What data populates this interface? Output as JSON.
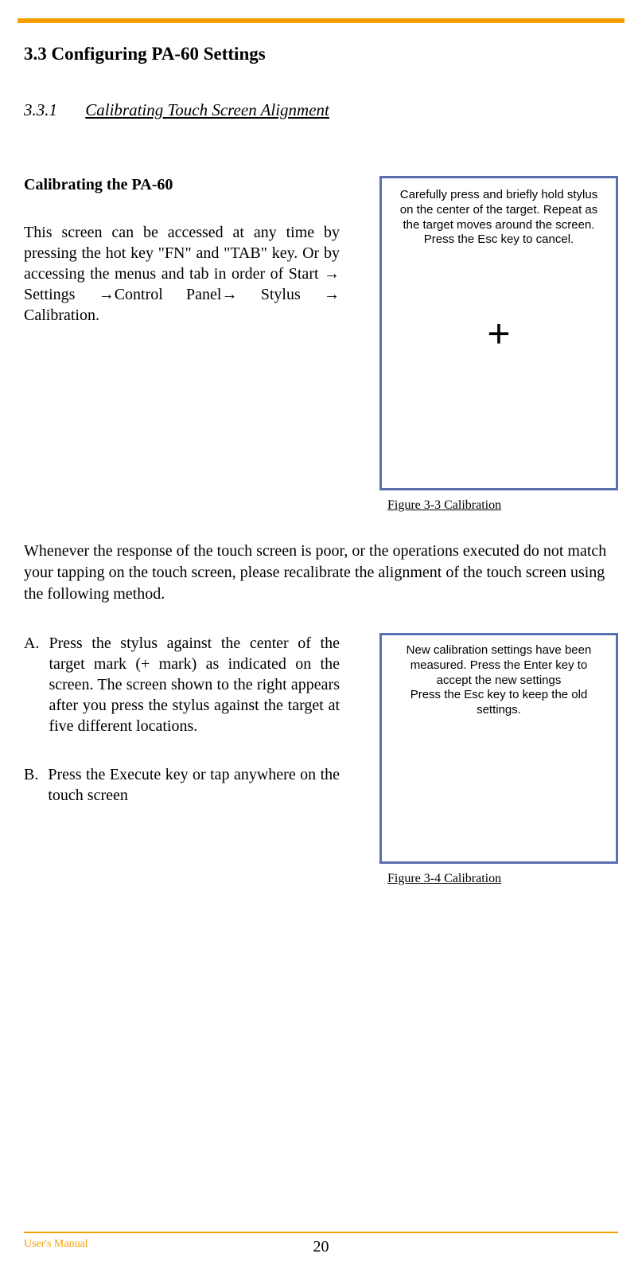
{
  "header": {},
  "section": {
    "heading": "3.3  Configuring PA-60 Settings",
    "subsection_num": "3.3.1",
    "subsection_title": "Calibrating Touch Screen Alignment"
  },
  "block1": {
    "subhead": "Calibrating the PA-60",
    "para": "This screen can be accessed at any time by pressing the hot key \"FN\" and \"TAB\" key. Or by accessing the menus and tab in order of Start → Settings →Control Panel→ Stylus → Calibration."
  },
  "figure1": {
    "line1": "Carefully press and briefly hold stylus",
    "line2": "on the center of the target. Repeat as",
    "line3": "the target moves around the screen.",
    "line4": "Press the Esc key to cancel.",
    "caption": "Figure 3-3 Calibration"
  },
  "mid_para": "Whenever the response of the touch screen is poor, or the operations executed do not match your tapping on the touch screen, please recalibrate the alignment of the touch screen using the following method.",
  "list": {
    "a_marker": "A.",
    "a_text": "Press the stylus against the center of the target mark (+ mark) as indicated on the screen. The screen shown to the right appears after you press the stylus against the target at five different locations.",
    "b_marker": "B.",
    "b_text": "Press the Execute key or tap anywhere on the touch screen"
  },
  "figure2": {
    "line1": "New calibration settings have been",
    "line2": "measured. Press the Enter key to",
    "line3": "accept the new settings",
    "line4": "Press the Esc key to keep the old settings.",
    "caption": "Figure 3-4 Calibration"
  },
  "footer": {
    "label": "User's Manual",
    "page": "20"
  }
}
